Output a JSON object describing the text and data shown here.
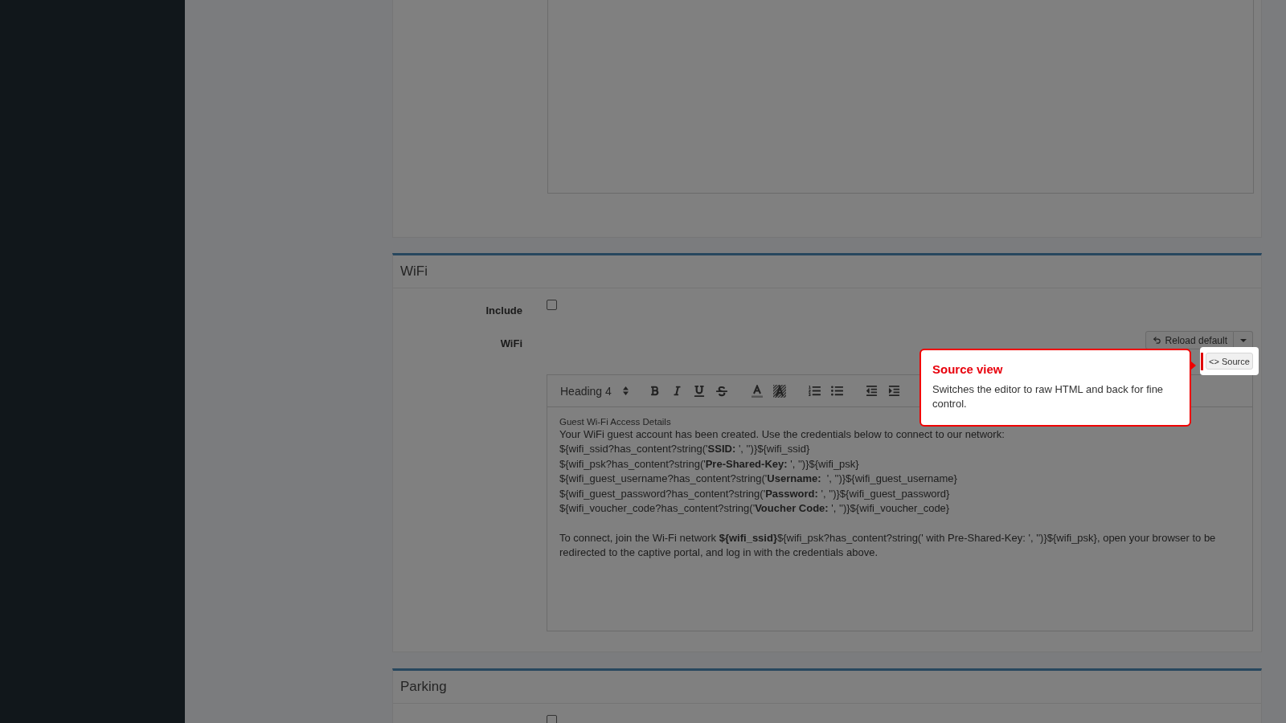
{
  "sections": [
    {
      "title": "WiFi",
      "fields": [
        {
          "kind": "checkbox",
          "label": "Include",
          "checked": false
        },
        {
          "kind": "editor",
          "label": "WiFi",
          "reload_button": {
            "label": "Reload default"
          },
          "source_button": {
            "label": "<> Source",
            "highlighted": true
          },
          "toolbar": {
            "block_format": "Heading 4"
          },
          "content": {
            "heading": "Guest Wi-Fi Access Details",
            "lines": [
              "Your WiFi guest account has been created. Use the credentials below to connect to our network:",
              "${wifi_ssid?has_content?string('**SSID:** ', '')}${wifi_ssid}",
              "${wifi_psk?has_content?string('**Pre-Shared-Key:** ', '')}${wifi_psk}",
              "${wifi_guest_username?has_content?string('**Username:**  ', '')}${wifi_guest_username}",
              "${wifi_guest_password?has_content?string('**Password:** ', '')}${wifi_guest_password}",
              "${wifi_voucher_code?has_content?string('**Voucher Code:** ', '')}${wifi_voucher_code}"
            ],
            "paragraph": "To connect, join the Wi-Fi network **${wifi_ssid}**${wifi_psk?has_content?string(' with Pre-Shared-Key: ', '')}${wifi_psk}, open your browser to be redirected to the captive portal, and log in with the credentials above."
          }
        }
      ]
    },
    {
      "title": "Parking",
      "fields": [
        {
          "kind": "checkbox",
          "checked": false
        }
      ]
    }
  ],
  "tooltip": {
    "title": "Source view",
    "text": "Switches the editor to raw HTML and back for fine control."
  }
}
